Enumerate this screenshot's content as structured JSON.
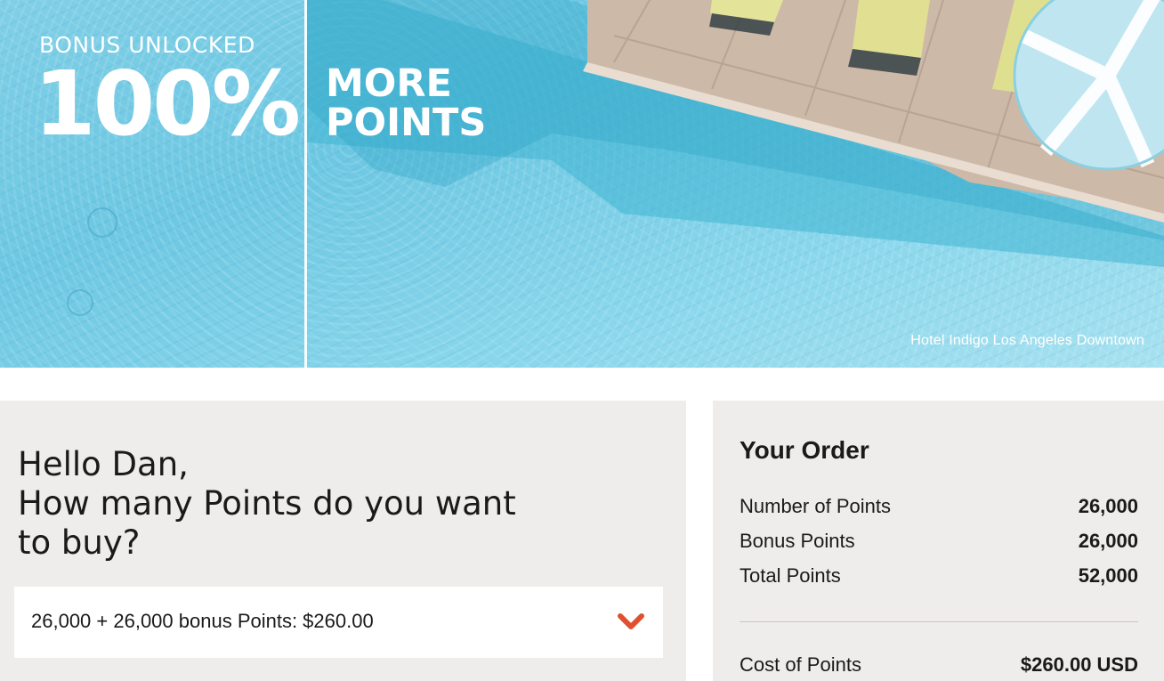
{
  "hero": {
    "bonus_label": "BONUS UNLOCKED",
    "bonus_percent": "100%",
    "headline_line1": "MORE",
    "headline_line2": "POINTS",
    "photo_caption": "Hotel Indigo Los Angeles Downtown"
  },
  "purchase": {
    "greeting_line1": "Hello Dan,",
    "greeting_line2": "How many Points do you want",
    "greeting_line3": "to buy?",
    "selected_option": "26,000 + 26,000 bonus Points: $260.00",
    "accent_color": "#e0502e"
  },
  "order": {
    "title": "Your Order",
    "rows": [
      {
        "label": "Number of Points",
        "value": "26,000"
      },
      {
        "label": "Bonus Points",
        "value": "26,000"
      },
      {
        "label": "Total Points",
        "value": "52,000"
      }
    ],
    "cost": {
      "label": "Cost of Points",
      "value": "$260.00 USD"
    }
  }
}
